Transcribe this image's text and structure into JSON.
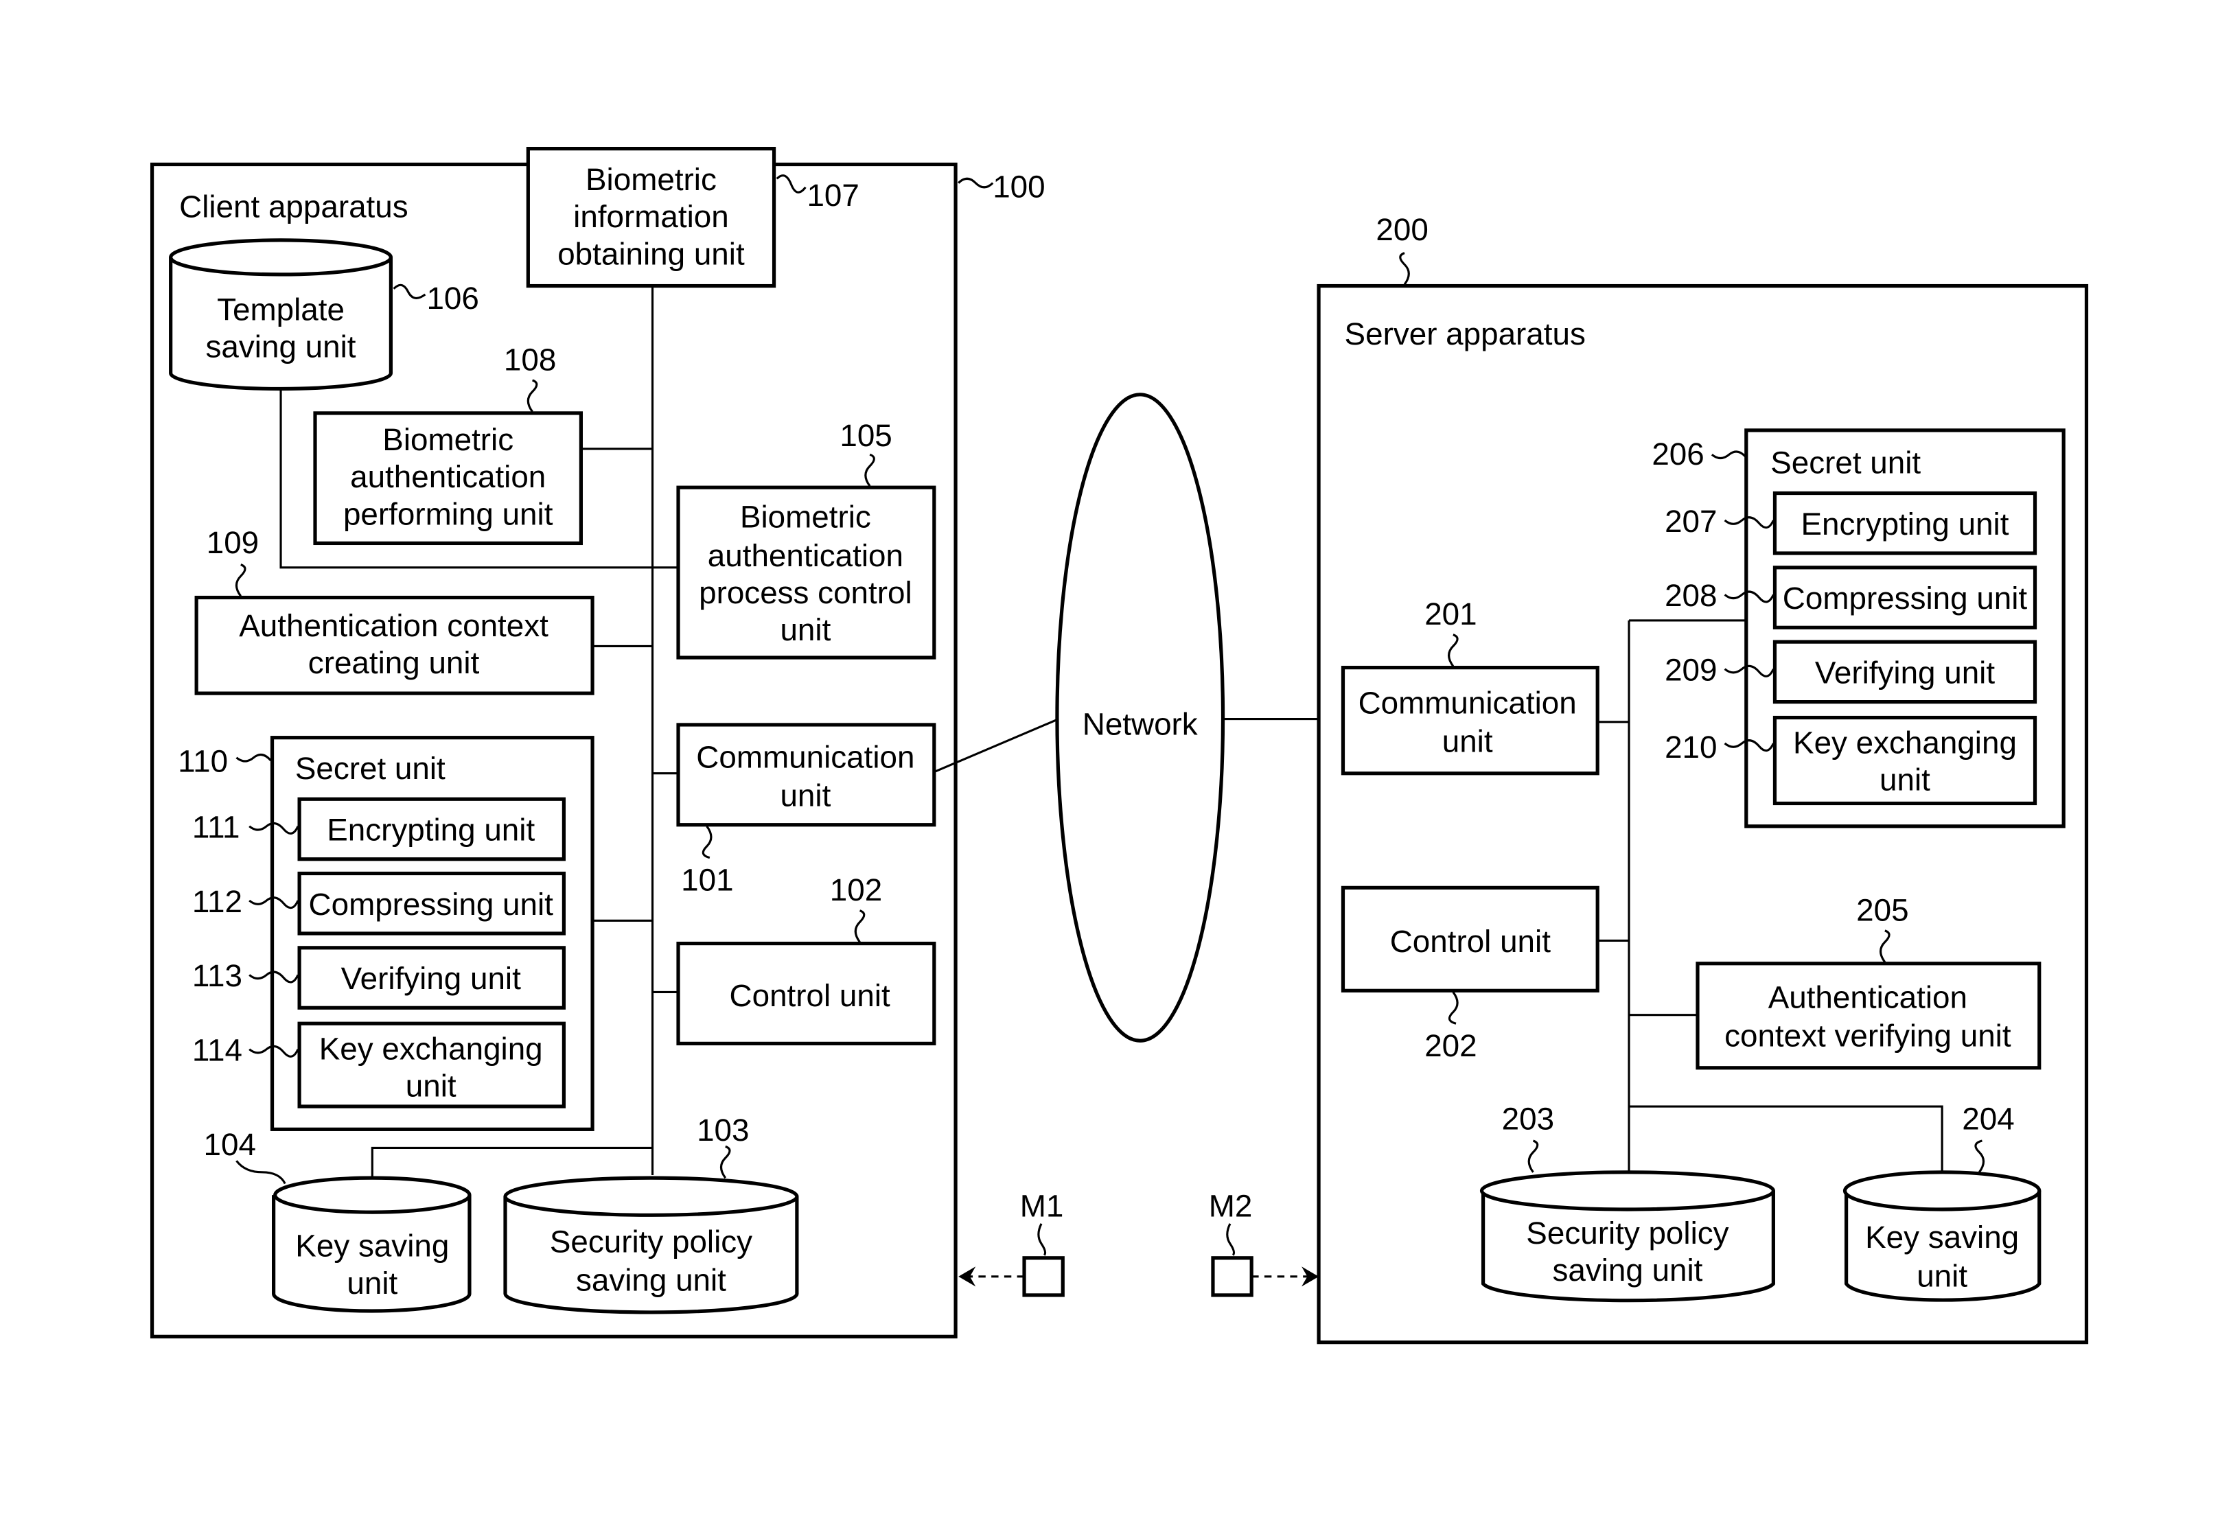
{
  "client": {
    "title": "Client apparatus",
    "ref": "100",
    "units": {
      "bio_info": {
        "ref": "107",
        "lines": [
          "Biometric",
          "information",
          "obtaining unit"
        ]
      },
      "template": {
        "ref": "106",
        "lines": [
          "Template",
          "saving unit"
        ]
      },
      "bio_auth_perf": {
        "ref": "108",
        "lines": [
          "Biometric",
          "authentication",
          "performing unit"
        ]
      },
      "bio_proc_ctrl": {
        "ref": "105",
        "lines": [
          "Biometric",
          "authentication",
          "process control",
          "unit"
        ]
      },
      "auth_ctx_create": {
        "ref": "109",
        "lines": [
          "Authentication context",
          "creating unit"
        ]
      },
      "secret": {
        "ref": "110",
        "title": "Secret unit"
      },
      "encrypting": {
        "ref": "111",
        "label": "Encrypting unit"
      },
      "compressing": {
        "ref": "112",
        "label": "Compressing unit"
      },
      "verifying": {
        "ref": "113",
        "label": "Verifying unit"
      },
      "key_exchanging": {
        "ref": "114",
        "lines": [
          "Key exchanging",
          "unit"
        ]
      },
      "communication": {
        "ref": "101",
        "lines": [
          "Communication",
          "unit"
        ]
      },
      "control": {
        "ref": "102",
        "label": "Control unit"
      },
      "security_policy": {
        "ref": "103",
        "lines": [
          "Security policy",
          "saving unit"
        ]
      },
      "key_saving": {
        "ref": "104",
        "lines": [
          "Key saving",
          "unit"
        ]
      }
    }
  },
  "network": {
    "label": "Network"
  },
  "server": {
    "title": "Server apparatus",
    "ref": "200",
    "units": {
      "communication": {
        "ref": "201",
        "lines": [
          "Communication",
          "unit"
        ]
      },
      "control": {
        "ref": "202",
        "label": "Control unit"
      },
      "security_policy": {
        "ref": "203",
        "lines": [
          "Security policy",
          "saving unit"
        ]
      },
      "key_saving": {
        "ref": "204",
        "lines": [
          "Key saving",
          "unit"
        ]
      },
      "auth_ctx_verify": {
        "ref": "205",
        "lines": [
          "Authentication",
          "context verifying unit"
        ]
      },
      "secret": {
        "ref": "206",
        "title": "Secret unit"
      },
      "encrypting": {
        "ref": "207",
        "label": "Encrypting unit"
      },
      "compressing": {
        "ref": "208",
        "label": "Compressing unit"
      },
      "verifying": {
        "ref": "209",
        "label": "Verifying unit"
      },
      "key_exchanging": {
        "ref": "210",
        "lines": [
          "Key exchanging",
          "unit"
        ]
      }
    }
  },
  "media": {
    "m1": {
      "label": "M1"
    },
    "m2": {
      "label": "M2"
    }
  }
}
